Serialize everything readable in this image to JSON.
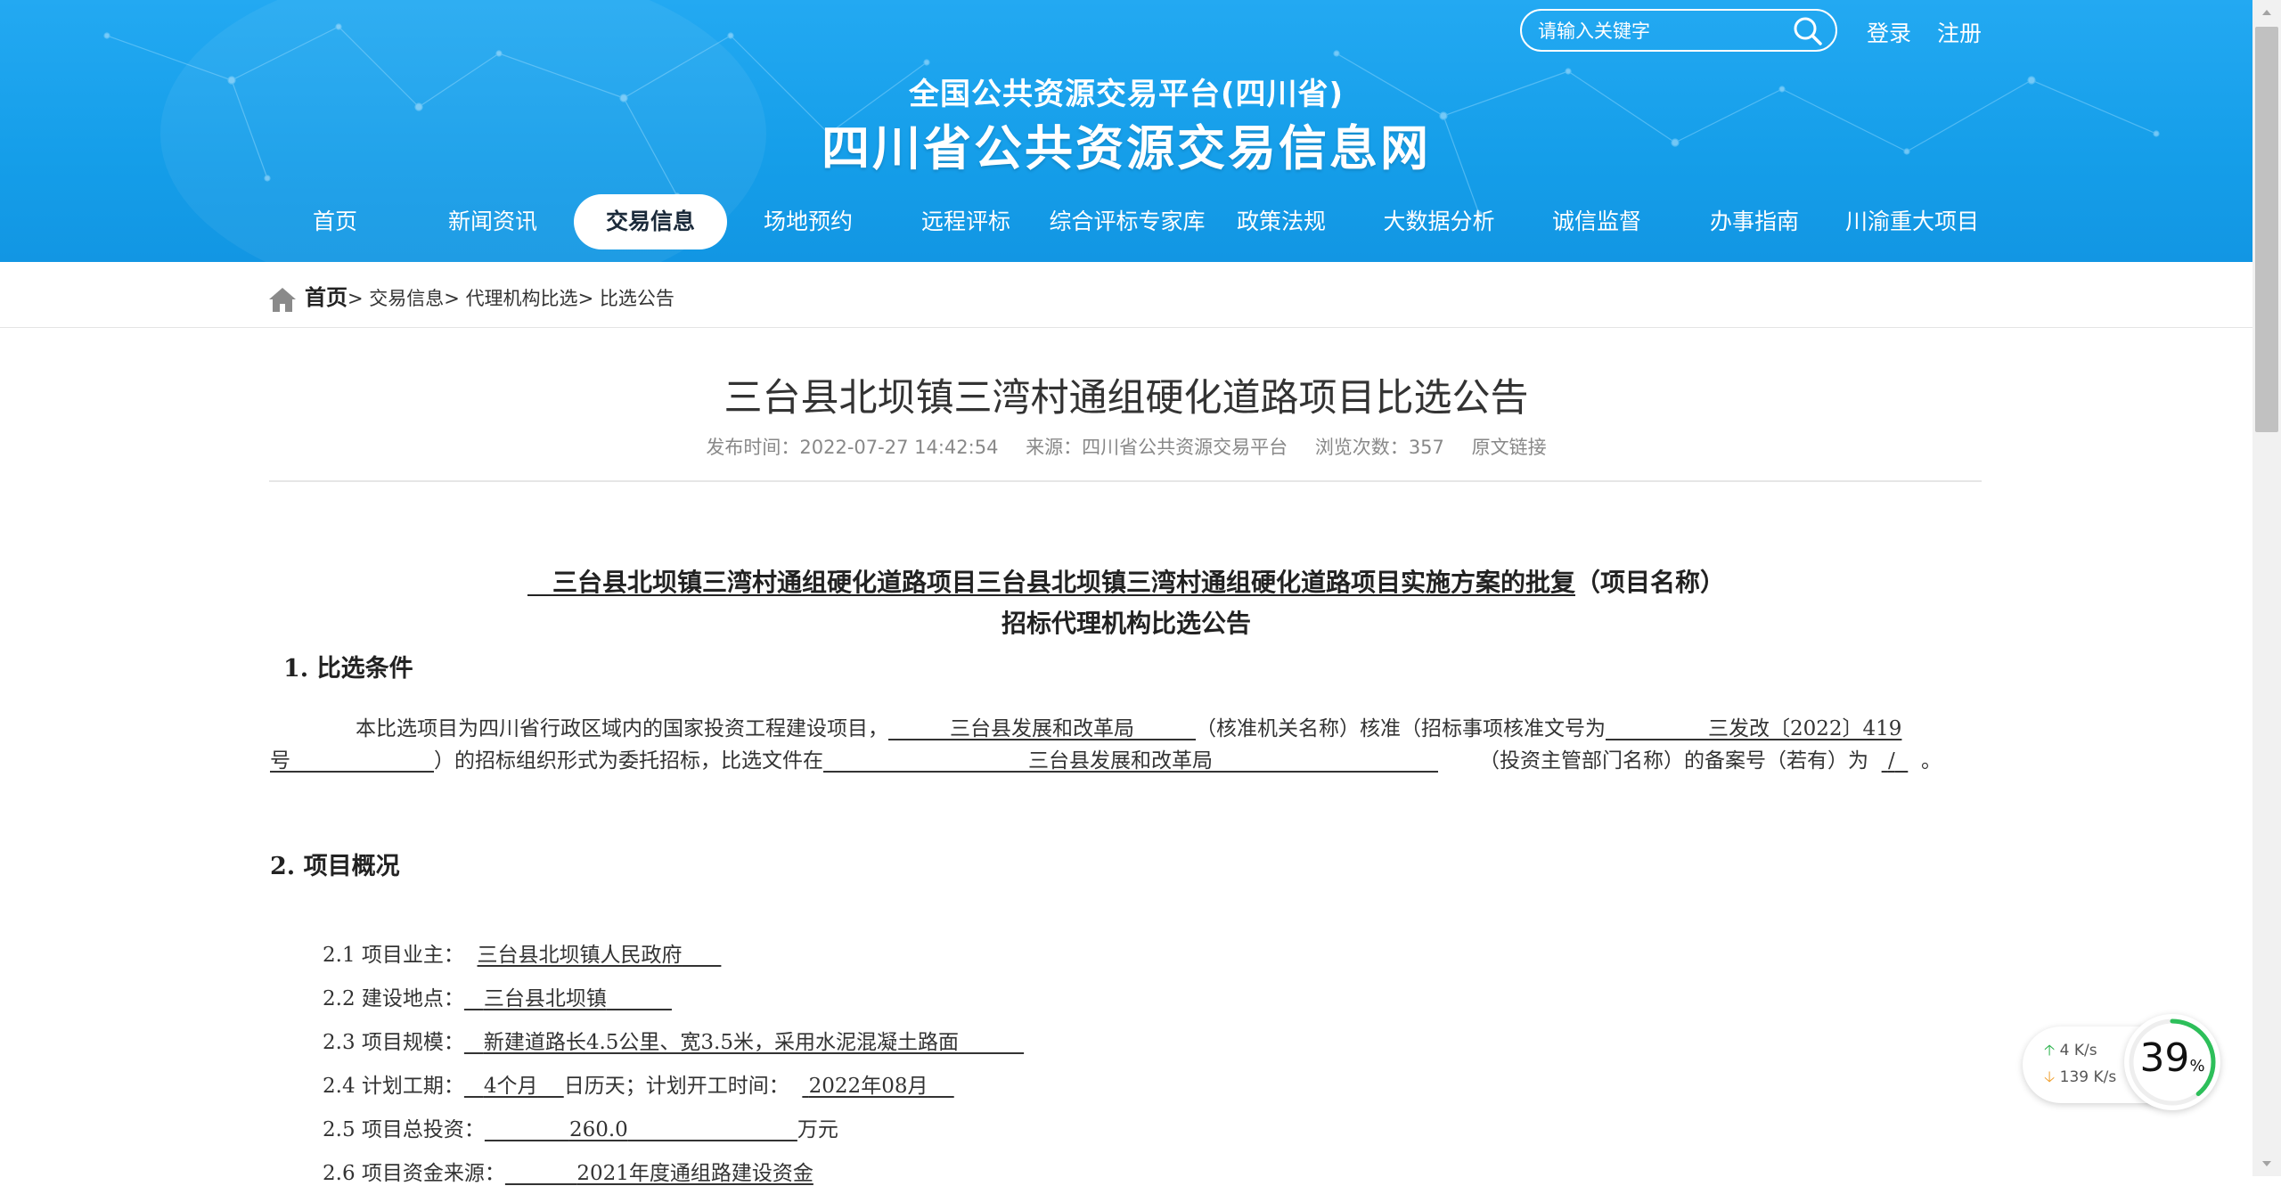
{
  "header": {
    "site_subtitle": "全国公共资源交易平台(四川省)",
    "site_title": "四川省公共资源交易信息网",
    "search_placeholder": "请输入关键字",
    "login": "登录",
    "register": "注册",
    "brand_color": "#1fa3ef"
  },
  "nav": {
    "items": [
      "首页",
      "新闻资讯",
      "交易信息",
      "场地预约",
      "远程评标",
      "综合评标专家库",
      "政策法规",
      "大数据分析",
      "诚信监督",
      "办事指南",
      "川渝重大项目"
    ],
    "active_index": 2
  },
  "breadcrumb": {
    "home": "首页",
    "sep": "> ",
    "items": [
      "交易信息",
      "代理机构比选",
      "比选公告"
    ]
  },
  "article": {
    "title": "三台县北坝镇三湾村通组硬化道路项目比选公告",
    "publish_label": "发布时间：",
    "publish_time": "2022-07-27 14:42:54",
    "source_label": "来源：",
    "source": "四川省公共资源交易平台",
    "views_label": "浏览次数：",
    "views": "357",
    "original_link": "原文链接"
  },
  "doc": {
    "heading_project": "三台县北坝镇三湾村通组硬化道路项目三台县北坝镇三湾村通组硬化道路项目实施方案的批复",
    "heading_project_suffix": "（项目名称）",
    "heading_line2": "招标代理机构比选公告",
    "sec1": "1.   比选条件",
    "p1_a": "本比选项目为四川省行政区域内的国家投资工程建设项目，",
    "p1_b": "三台县发展和改革局",
    "p1_c": "（核准机关名称）核准（招标事项核准文号为",
    "p1_d": "三发改〔2022〕419号",
    "p1_e": "）的招标组织形式为委托招标，比选文件在",
    "p1_f": "三台县发展和改革局",
    "p1_g": "（投资主管部门名称）的备案号（若有）为",
    "p1_h": "/",
    "p1_i": "。",
    "sec2": "2.  项目概况",
    "items": {
      "i1_label": "2.1  项目业主：",
      "i1_value": "三台县北坝镇人民政府",
      "i2_label": "2.2  建设地点：",
      "i2_value": "三台县北坝镇",
      "i3_label": "2.3  项目规模：",
      "i3_value": "新建道路长4.5公里、宽3.5米，采用水泥混凝土路面",
      "i4_label": "2.4  计划工期：",
      "i4_value": "4个月",
      "i4_mid": "日历天；计划开工时间：",
      "i4_date": "2022年08月",
      "i5_label": "2.5  项目总投资：",
      "i5_value": "260.0",
      "i5_unit": "万元",
      "i6_label": "2.6  项目资金来源：",
      "i6_value": "2021年度通组路建设资金"
    }
  },
  "widget": {
    "upload": "4   K/s",
    "download": "139 K/s",
    "percent": "39",
    "percent_sign": "%",
    "percent_value": 39
  }
}
